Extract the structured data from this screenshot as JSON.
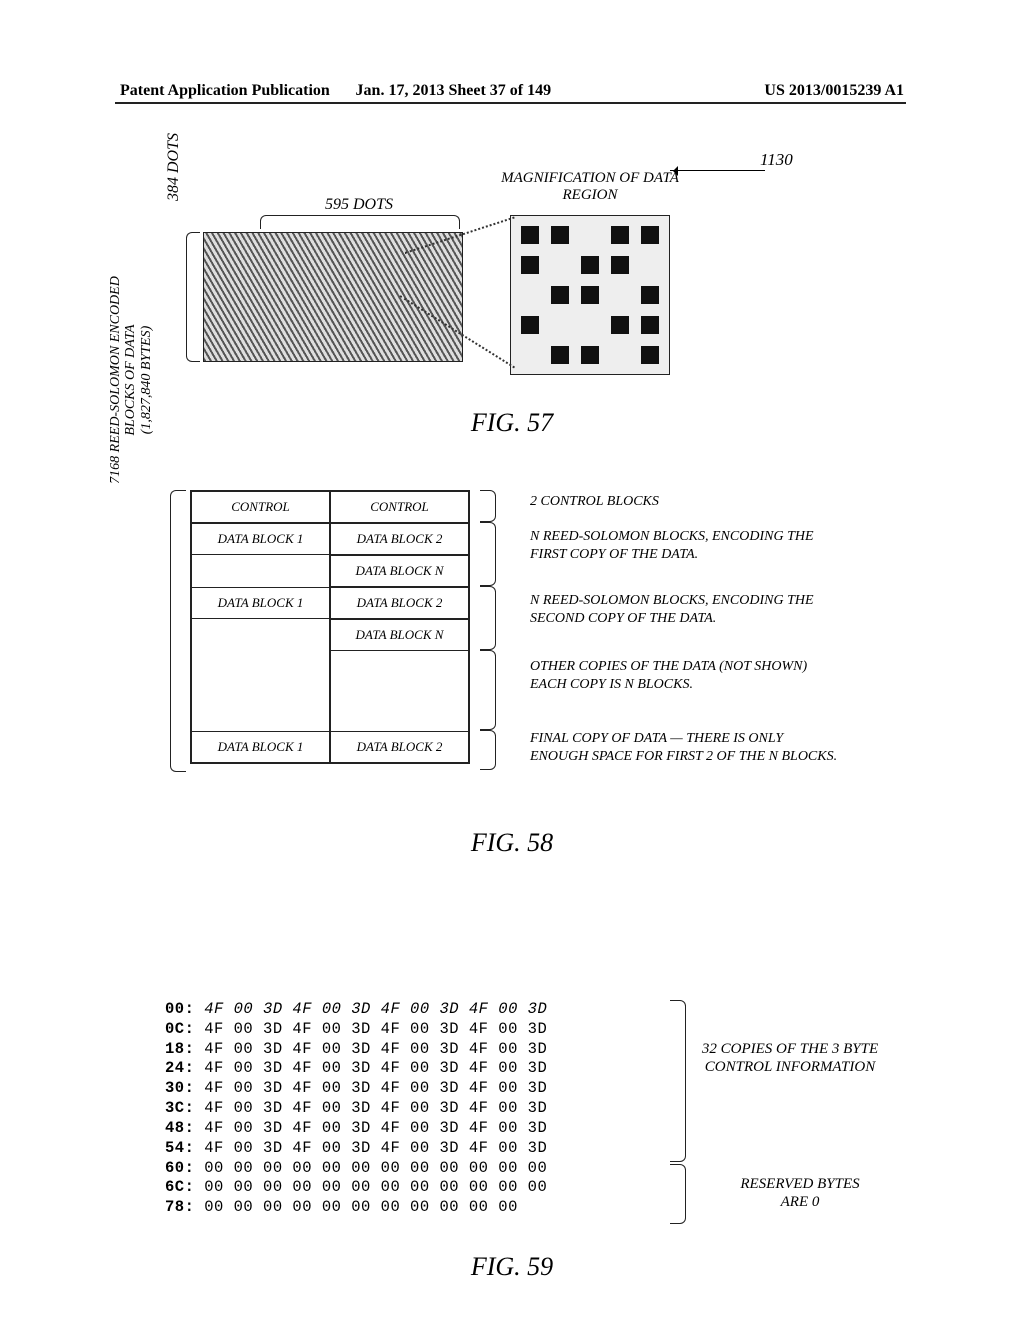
{
  "header": {
    "left": "Patent Application Publication",
    "center": "Jan. 17, 2013  Sheet 37 of 149",
    "right": "US 2013/0015239 A1"
  },
  "fig57": {
    "width_label": "595 DOTS",
    "height_label": "384 DOTS",
    "mag_label": "MAGNIFICATION OF DATA REGION",
    "ref": "1130",
    "caption": "FIG. 57"
  },
  "fig58": {
    "side_label_line1": "7168 REED-SOLOMON ENCODED",
    "side_label_line2": "BLOCKS OF DATA",
    "side_label_line3": "(1,827,840 BYTES)",
    "cells": {
      "control": "CONTROL",
      "db1": "DATA BLOCK 1",
      "db2": "DATA BLOCK 2",
      "dbn": "DATA BLOCK N"
    },
    "annot": {
      "a1": "2 CONTROL BLOCKS",
      "a2": "N REED-SOLOMON BLOCKS, ENCODING THE FIRST COPY OF THE DATA.",
      "a3": "N REED-SOLOMON BLOCKS, ENCODING THE SECOND COPY OF THE DATA.",
      "a4": "OTHER COPIES OF THE DATA (NOT SHOWN) EACH COPY IS N BLOCKS.",
      "a5": "FINAL COPY OF DATA — THERE IS ONLY ENOUGH SPACE FOR FIRST 2 OF THE N BLOCKS."
    },
    "caption": "FIG. 58"
  },
  "fig59": {
    "rows": [
      {
        "addr": "00:",
        "bytes": "4F 00 3D 4F 00 3D 4F 00 3D 4F 00 3D"
      },
      {
        "addr": "0C:",
        "bytes": "4F 00 3D 4F 00 3D 4F 00 3D 4F 00 3D"
      },
      {
        "addr": "18:",
        "bytes": "4F 00 3D 4F 00 3D 4F 00 3D 4F 00 3D"
      },
      {
        "addr": "24:",
        "bytes": "4F 00 3D 4F 00 3D 4F 00 3D 4F 00 3D"
      },
      {
        "addr": "30:",
        "bytes": "4F 00 3D 4F 00 3D 4F 00 3D 4F 00 3D"
      },
      {
        "addr": "3C:",
        "bytes": "4F 00 3D 4F 00 3D 4F 00 3D 4F 00 3D"
      },
      {
        "addr": "48:",
        "bytes": "4F 00 3D 4F 00 3D 4F 00 3D 4F 00 3D"
      },
      {
        "addr": "54:",
        "bytes": "4F 00 3D 4F 00 3D 4F 00 3D 4F 00 3D"
      },
      {
        "addr": "60:",
        "bytes": "00 00 00 00 00 00 00 00 00 00 00 00"
      },
      {
        "addr": "6C:",
        "bytes": "00 00 00 00 00 00 00 00 00 00 00 00"
      },
      {
        "addr": "78:",
        "bytes": "00 00 00 00 00 00 00 00 00 00 00"
      }
    ],
    "annot1": "32 COPIES OF THE 3 BYTE CONTROL INFORMATION",
    "annot2": "RESERVED BYTES ARE 0",
    "caption": "FIG. 59"
  }
}
